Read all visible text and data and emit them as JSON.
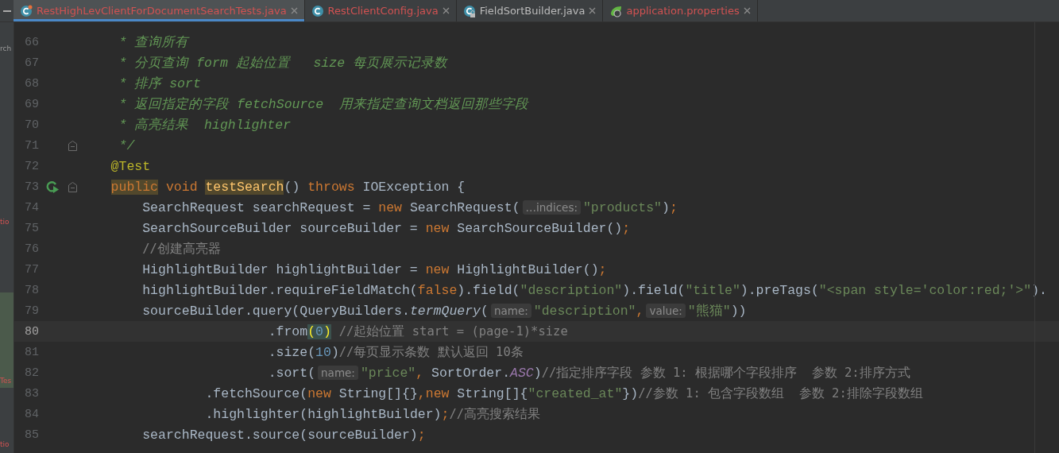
{
  "tabs": [
    {
      "label": "RestHighLevClientForDocumentSearchTests.java",
      "kind": "class",
      "selected": true,
      "error": true,
      "locked": false
    },
    {
      "label": "RestClientConfig.java",
      "kind": "class",
      "selected": false,
      "error": true,
      "locked": false
    },
    {
      "label": "FieldSortBuilder.java",
      "kind": "class",
      "selected": false,
      "error": false,
      "locked": true
    },
    {
      "label": "application.properties",
      "kind": "properties",
      "selected": false,
      "error": true,
      "locked": false
    }
  ],
  "side_strip": [
    {
      "label": "rch",
      "error": false
    },
    {
      "label": "tio",
      "error": true
    },
    {
      "label": "Tes",
      "error": true
    },
    {
      "label": "tio",
      "error": true
    }
  ],
  "lines": [
    {
      "number": "66",
      "current": false,
      "run": false,
      "fold": false,
      "tokens": [
        {
          "kind": "doc",
          "text": "     * 查询所有"
        }
      ]
    },
    {
      "number": "67",
      "current": false,
      "run": false,
      "fold": false,
      "tokens": [
        {
          "kind": "doc",
          "text": "     * 分页查询 form 起始位置   size 每页展示记录数"
        }
      ]
    },
    {
      "number": "68",
      "current": false,
      "run": false,
      "fold": false,
      "tokens": [
        {
          "kind": "doc",
          "text": "     * 排序 sort"
        }
      ]
    },
    {
      "number": "69",
      "current": false,
      "run": false,
      "fold": false,
      "tokens": [
        {
          "kind": "doc",
          "text": "     * 返回指定的字段 fetchSource  用来指定查询文档返回那些字段"
        }
      ]
    },
    {
      "number": "70",
      "current": false,
      "run": false,
      "fold": false,
      "tokens": [
        {
          "kind": "doc",
          "text": "     * 高亮结果  highlighter"
        }
      ]
    },
    {
      "number": "71",
      "current": false,
      "run": false,
      "fold": true,
      "tokens": [
        {
          "kind": "doc",
          "text": "     */"
        }
      ]
    },
    {
      "number": "72",
      "current": false,
      "run": false,
      "fold": false,
      "tokens": [
        {
          "kind": "annotation",
          "text": "    @Test"
        }
      ]
    },
    {
      "number": "73",
      "current": false,
      "run": true,
      "fold": true,
      "tokens": [
        {
          "kind": "keyword_marked",
          "text": "    public"
        },
        {
          "kind": "keyword",
          "text": " void"
        },
        {
          "kind": "method_marked",
          "text": " testSearch"
        },
        {
          "kind": "plain",
          "text": "() "
        },
        {
          "kind": "keyword",
          "text": "throws"
        },
        {
          "kind": "plain",
          "text": " IOException {"
        }
      ]
    },
    {
      "number": "74",
      "current": false,
      "run": false,
      "fold": false,
      "tokens": [
        {
          "kind": "plain",
          "text": "        SearchRequest searchRequest = "
        },
        {
          "kind": "keyword",
          "text": "new"
        },
        {
          "kind": "plain",
          "text": " SearchRequest("
        },
        {
          "kind": "hint",
          "text": "…indices:"
        },
        {
          "kind": "string",
          "text": "\"products\""
        },
        {
          "kind": "plain",
          "text": ")"
        },
        {
          "kind": "keyword",
          "text": ";"
        }
      ]
    },
    {
      "number": "75",
      "current": false,
      "run": false,
      "fold": false,
      "tokens": [
        {
          "kind": "plain",
          "text": "        SearchSourceBuilder sourceBuilder = "
        },
        {
          "kind": "keyword",
          "text": "new"
        },
        {
          "kind": "plain",
          "text": " SearchSourceBuilder()"
        },
        {
          "kind": "keyword",
          "text": ";"
        }
      ]
    },
    {
      "number": "76",
      "current": false,
      "run": false,
      "fold": false,
      "tokens": [
        {
          "kind": "comment",
          "text": "        //创建高亮器"
        }
      ]
    },
    {
      "number": "77",
      "current": false,
      "run": false,
      "fold": false,
      "tokens": [
        {
          "kind": "plain",
          "text": "        HighlightBuilder highlightBuilder = "
        },
        {
          "kind": "keyword",
          "text": "new"
        },
        {
          "kind": "plain",
          "text": " HighlightBuilder()"
        },
        {
          "kind": "keyword",
          "text": ";"
        }
      ]
    },
    {
      "number": "78",
      "current": false,
      "run": false,
      "fold": false,
      "tokens": [
        {
          "kind": "plain",
          "text": "        highlightBuilder.requireFieldMatch("
        },
        {
          "kind": "keyword",
          "text": "false"
        },
        {
          "kind": "plain",
          "text": ").field("
        },
        {
          "kind": "string",
          "text": "\"description\""
        },
        {
          "kind": "plain",
          "text": ").field("
        },
        {
          "kind": "string",
          "text": "\"title\""
        },
        {
          "kind": "plain",
          "text": ").preTags("
        },
        {
          "kind": "string",
          "text": "\"<span style='color:red;'>\""
        },
        {
          "kind": "plain",
          "text": ")."
        }
      ]
    },
    {
      "number": "79",
      "current": false,
      "run": false,
      "fold": false,
      "tokens": [
        {
          "kind": "plain",
          "text": "        sourceBuilder.query(QueryBuilders."
        },
        {
          "kind": "italic",
          "text": "termQuery"
        },
        {
          "kind": "plain",
          "text": "("
        },
        {
          "kind": "hint",
          "text": "name:"
        },
        {
          "kind": "string",
          "text": "\"description\""
        },
        {
          "kind": "keyword",
          "text": ","
        },
        {
          "kind": "hint",
          "text": "value:"
        },
        {
          "kind": "string",
          "text": "\"熊猫\""
        },
        {
          "kind": "plain",
          "text": "))"
        }
      ]
    },
    {
      "number": "80",
      "current": true,
      "run": false,
      "fold": false,
      "tokens": [
        {
          "kind": "plain",
          "text": "                        .from"
        },
        {
          "kind": "brace",
          "text": "("
        },
        {
          "kind": "number",
          "text": "0"
        },
        {
          "kind": "brace",
          "text": ")"
        },
        {
          "kind": "comment",
          "text": " //起始位置 start = (page-1)*size"
        }
      ]
    },
    {
      "number": "81",
      "current": false,
      "run": false,
      "fold": false,
      "tokens": [
        {
          "kind": "plain",
          "text": "                        .size("
        },
        {
          "kind": "number",
          "text": "10"
        },
        {
          "kind": "plain",
          "text": ")"
        },
        {
          "kind": "comment",
          "text": "//每页显示条数 默认返回 10条"
        }
      ]
    },
    {
      "number": "82",
      "current": false,
      "run": false,
      "fold": false,
      "tokens": [
        {
          "kind": "plain",
          "text": "                        .sort("
        },
        {
          "kind": "hint",
          "text": "name:"
        },
        {
          "kind": "string",
          "text": "\"price\""
        },
        {
          "kind": "keyword",
          "text": ","
        },
        {
          "kind": "plain",
          "text": " SortOrder."
        },
        {
          "kind": "constant",
          "text": "ASC"
        },
        {
          "kind": "plain",
          "text": ")"
        },
        {
          "kind": "comment",
          "text": "//指定排序字段 参数 1: 根据哪个字段排序  参数 2:排序方式"
        }
      ]
    },
    {
      "number": "83",
      "current": false,
      "run": false,
      "fold": false,
      "tokens": [
        {
          "kind": "plain",
          "text": "                .fetchSource("
        },
        {
          "kind": "keyword",
          "text": "new"
        },
        {
          "kind": "plain",
          "text": " String[]{}"
        },
        {
          "kind": "keyword",
          "text": ","
        },
        {
          "kind": "keyword",
          "text": "new"
        },
        {
          "kind": "plain",
          "text": " String[]{"
        },
        {
          "kind": "string",
          "text": "\"created_at\""
        },
        {
          "kind": "plain",
          "text": "})"
        },
        {
          "kind": "comment",
          "text": "//参数 1: 包含字段数组  参数 2:排除字段数组"
        }
      ]
    },
    {
      "number": "84",
      "current": false,
      "run": false,
      "fold": false,
      "tokens": [
        {
          "kind": "plain",
          "text": "                .highlighter(highlightBuilder)"
        },
        {
          "kind": "keyword",
          "text": ";"
        },
        {
          "kind": "comment",
          "text": "//高亮搜索结果"
        }
      ]
    },
    {
      "number": "85",
      "current": false,
      "run": false,
      "fold": false,
      "tokens": [
        {
          "kind": "plain",
          "text": "        searchRequest.source(sourceBuilder)"
        },
        {
          "kind": "keyword",
          "text": ";"
        }
      ]
    }
  ]
}
